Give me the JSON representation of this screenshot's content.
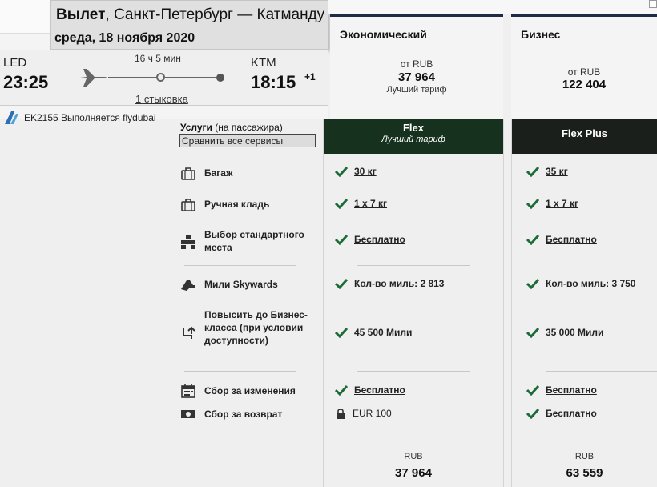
{
  "header": {
    "title_bold": "Вылет",
    "title_rest": ", Санкт-Петербург — Катманду",
    "date": "среда, 18 ноября 2020"
  },
  "flight": {
    "origin_code": "LED",
    "origin_time": "23:25",
    "dest_code": "KTM",
    "dest_time": "18:15",
    "day_offset": "+1",
    "duration": "16 ч 5 мин",
    "stops": "1 стыковка",
    "airline_info": "EK2155 Выполняется flydubai"
  },
  "classes": [
    {
      "name": "Экономический",
      "from": "от RUB",
      "price": "37 964",
      "note": "Лучший тариф"
    },
    {
      "name": "Бизнес",
      "from": "от RUB",
      "price": "122 404",
      "note": ""
    }
  ],
  "services": {
    "title_bold": "Услуги",
    "title_rest": " (на пассажира)",
    "compare_label": "Сравнить все сервисы",
    "rows": [
      {
        "label": "Багаж",
        "icon": "baggage-icon"
      },
      {
        "label": "Ручная кладь",
        "icon": "hand-luggage-icon"
      },
      {
        "label": "Выбор стандартного места",
        "icon": "seat-selection-icon"
      },
      {
        "label": "Мили Skywards",
        "icon": "skywards-miles-icon"
      },
      {
        "label": "Повысить до Бизнес-класса (при условии доступности)",
        "icon": "upgrade-seat-icon"
      },
      {
        "label": "Сбор за изменения",
        "icon": "calendar-change-icon"
      },
      {
        "label": "Сбор за возврат",
        "icon": "refund-money-icon"
      }
    ]
  },
  "fares": [
    {
      "name": "Flex",
      "subtitle": "Лучший тариф",
      "header_color": "#16321f",
      "values": [
        "30 кг",
        "1 x 7 кг",
        "Бесплатно",
        "Кол-во миль: 2 813",
        "45 500 Мили",
        "Бесплатно",
        "EUR 100"
      ],
      "total_currency": "RUB",
      "total_price": "37 964"
    },
    {
      "name": "Flex Plus",
      "subtitle": "",
      "header_color": "#1a1f1b",
      "values": [
        "35 кг",
        "1 x 7 кг",
        "Бесплатно",
        "Кол-во миль: 3 750",
        "35 000 Мили",
        "Бесплатно",
        "Бесплатно"
      ],
      "total_currency": "RUB",
      "total_price": "63 559"
    }
  ],
  "colors": {
    "check": "#1e6b3a",
    "class_accent": "#1f2a44"
  }
}
